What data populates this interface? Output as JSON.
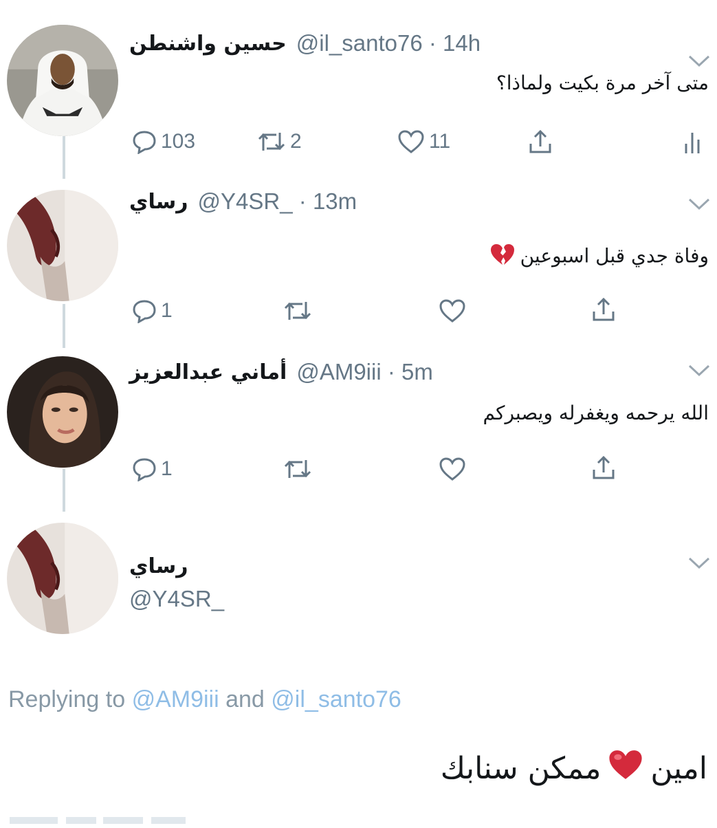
{
  "tweets": [
    {
      "name": "حسين واشنطن",
      "handle": "@il_santo76",
      "time": "14h",
      "text": "متى آخر مرة بكيت ولماذا؟",
      "reply_count": "103",
      "retweet_count": "2",
      "like_count": "11"
    },
    {
      "name": "رساي",
      "handle": "@Y4SR_",
      "time": "13m",
      "text": "وفاة جدي قبل اسبوعين",
      "emoji": "broken-heart-icon",
      "reply_count": "1",
      "retweet_count": "",
      "like_count": ""
    },
    {
      "name": "أماني عبدالعزيز",
      "handle": "@AM9iii",
      "time": "5m",
      "text": "الله يرحمه ويغفرله ويصبركم",
      "reply_count": "1",
      "retweet_count": "",
      "like_count": ""
    }
  ],
  "composer": {
    "name": "رساي",
    "handle": "@Y4SR_",
    "replying_prefix": "Replying to",
    "replying_mention_1": "@AM9iii",
    "replying_and": "and",
    "replying_mention_2": "@il_santo76",
    "text_before_heart": "امين",
    "text_after_heart": "ممكن سنابك",
    "emoji": "red-heart-icon"
  },
  "colors": {
    "text": "#14171a",
    "secondary": "#657786",
    "thread_line": "#cfd9de",
    "mention": "#8fbde6",
    "heart_red": "#d42a3c"
  }
}
